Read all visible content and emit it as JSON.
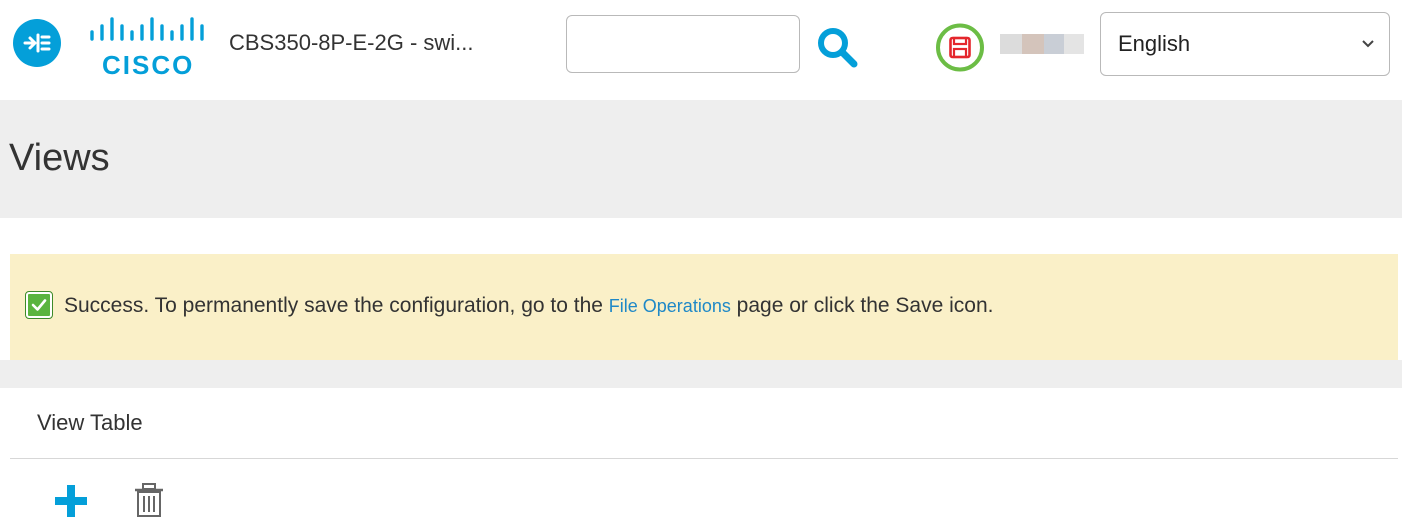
{
  "header": {
    "menu_icon": "sidebar-toggle-icon",
    "logo_text": "CISCO",
    "device_name": "CBS350-8P-E-2G - swi...",
    "search": {
      "value": "",
      "placeholder": ""
    },
    "search_icon": "search-icon",
    "save_icon": "save-icon",
    "language": {
      "selected": "English"
    }
  },
  "page": {
    "title": "Views"
  },
  "alert": {
    "type": "success",
    "text_before": "Success. To permanently save the configuration, go to the ",
    "link_text": "File Operations",
    "text_after": " page or click the Save icon."
  },
  "view_table": {
    "title": "View Table",
    "add_icon": "plus-icon",
    "delete_icon": "trash-icon"
  },
  "colors": {
    "brand_blue": "#049fd9",
    "save_red": "#e4262c",
    "highlight_green": "#6cbd45",
    "alert_background": "#faf0c8",
    "title_band": "#eeeeee"
  }
}
